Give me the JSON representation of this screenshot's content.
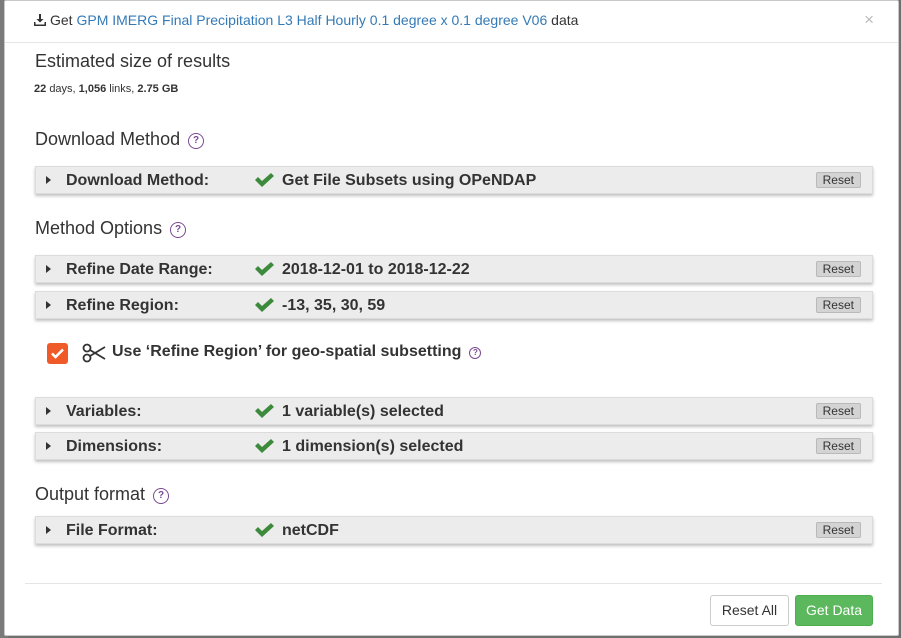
{
  "header": {
    "prefix": "Get",
    "dataset_link": "GPM IMERG Final Precipitation L3 Half Hourly 0.1 degree x 0.1 degree V06",
    "suffix": "data",
    "close_symbol": "×"
  },
  "estimate": {
    "title": "Estimated size of results",
    "days_value": "22",
    "days_unit": "days,",
    "links_value": "1,056",
    "links_unit": "links,",
    "size": "2.75 GB"
  },
  "sections": {
    "download_method": "Download Method",
    "method_options": "Method Options",
    "output_format": "Output format",
    "help_symbol": "?"
  },
  "panels": {
    "download_method": {
      "label": "Download Method:",
      "value": "Get File Subsets using OPeNDAP",
      "reset": "Reset"
    },
    "date_range": {
      "label": "Refine Date Range:",
      "value": "2018-12-01 to 2018-12-22",
      "reset": "Reset"
    },
    "region": {
      "label": "Refine Region:",
      "value": "-13, 35, 30, 59",
      "reset": "Reset"
    },
    "variables": {
      "label": "Variables:",
      "value": "1 variable(s) selected",
      "reset": "Reset"
    },
    "dimensions": {
      "label": "Dimensions:",
      "value": "1 dimension(s) selected",
      "reset": "Reset"
    },
    "file_format": {
      "label": "File Format:",
      "value": "netCDF",
      "reset": "Reset"
    }
  },
  "subset_option": {
    "label": "Use ‘Refine Region’ for geo-spatial subsetting",
    "checked": true,
    "checkbox_color": "#f05a28"
  },
  "footer": {
    "reset_all": "Reset All",
    "get_data": "Get Data"
  },
  "colors": {
    "link": "#337ab7",
    "check": "#3c8a3c",
    "help": "#7a4a91",
    "primary_button": "#5cb85c"
  },
  "icons": [
    "download-icon",
    "close-icon",
    "help-icon",
    "caret-right-icon",
    "checkmark-icon",
    "scissors-icon"
  ]
}
